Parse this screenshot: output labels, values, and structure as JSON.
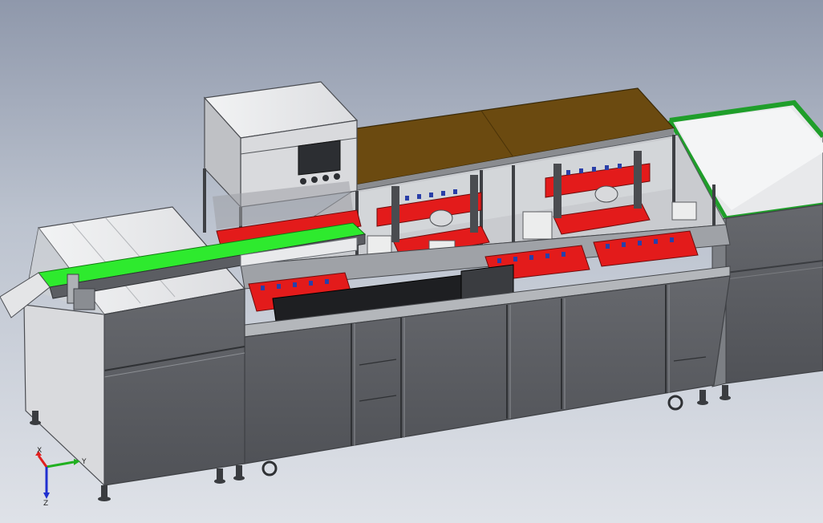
{
  "window": {
    "background_top": "#8f98ab",
    "background_bottom": "#dfe2e8"
  },
  "colors": {
    "frame": "#6b6f75",
    "panel_dark": "#5c5e63",
    "panel_light": "#e9eaec",
    "conveyor_green": "#2eea2e",
    "frame_green": "#1f9e2a",
    "fixture_red": "#e31b1b",
    "top_plate_brown": "#6b4a10",
    "axis_x": "#e02020",
    "axis_y": "#20b020",
    "axis_z": "#2030d0"
  },
  "triad": {
    "x_label": "X",
    "y_label": "Y",
    "z_label": "Z"
  },
  "machine": {
    "cabinet_bays": 7,
    "fixture_nests": 5,
    "control_buttons": 4,
    "casters": 6
  }
}
